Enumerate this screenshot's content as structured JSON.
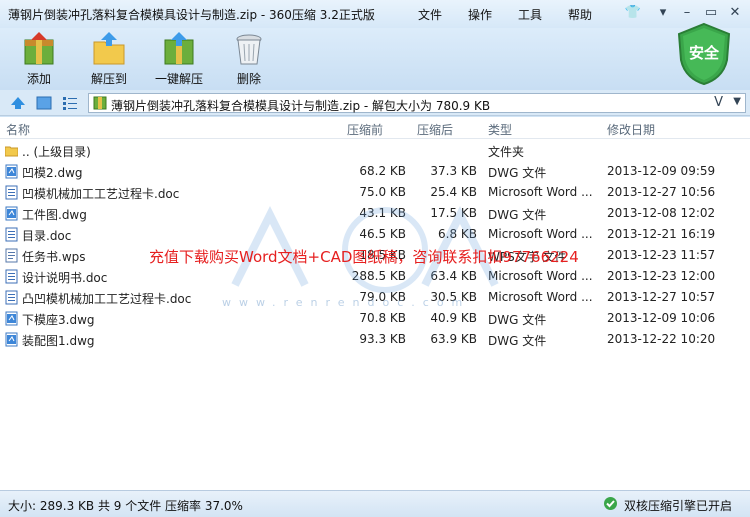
{
  "window": {
    "title": "薄钢片倒装冲孔落料复合模模具设计与制造.zip - 360压缩 3.2正式版",
    "menu": {
      "file": "文件",
      "action": "操作",
      "tools": "工具",
      "help": "帮助"
    }
  },
  "toolbar": {
    "add": "添加",
    "extract_to": "解压到",
    "one_click": "一键解压",
    "delete": "删除"
  },
  "badge": {
    "security": "安全"
  },
  "address": {
    "path": "薄钢片倒装冲孔落料复合模模具设计与制造.zip - 解包大小为 780.9 KB",
    "v_label": "V"
  },
  "columns": {
    "name": "名称",
    "packed": "压缩前",
    "unpacked": "压缩后",
    "type": "类型",
    "modified": "修改日期"
  },
  "files": [
    {
      "name": ".. (上级目录)",
      "packed": "",
      "unpacked": "",
      "type": "文件夹",
      "modified": "",
      "icon": "folder-icon"
    },
    {
      "name": "凹模2.dwg",
      "packed": "68.2 KB",
      "unpacked": "37.3 KB",
      "type": "DWG 文件",
      "modified": "2013-12-09 09:59",
      "icon": "dwg-icon"
    },
    {
      "name": "凹模机械加工工艺过程卡.doc",
      "packed": "75.0 KB",
      "unpacked": "25.4 KB",
      "type": "Microsoft Word ...",
      "modified": "2013-12-27 10:56",
      "icon": "doc-icon"
    },
    {
      "name": "工件图.dwg",
      "packed": "43.1 KB",
      "unpacked": "17.5 KB",
      "type": "DWG 文件",
      "modified": "2013-12-08 12:02",
      "icon": "dwg-icon"
    },
    {
      "name": "目录.doc",
      "packed": "46.5 KB",
      "unpacked": "6.8 KB",
      "type": "Microsoft Word ...",
      "modified": "2013-12-21 16:19",
      "icon": "doc-icon"
    },
    {
      "name": "任务书.wps",
      "packed": "18.5 KB",
      "unpacked": "",
      "type": "WPS文字 文件",
      "modified": "2013-12-23 11:57",
      "icon": "wps-icon"
    },
    {
      "name": "设计说明书.doc",
      "packed": "288.5 KB",
      "unpacked": "63.4 KB",
      "type": "Microsoft Word ...",
      "modified": "2013-12-23 12:00",
      "icon": "doc-icon"
    },
    {
      "name": "凸凹模机械加工工艺过程卡.doc",
      "packed": "79.0 KB",
      "unpacked": "30.5 KB",
      "type": "Microsoft Word ...",
      "modified": "2013-12-27 10:57",
      "icon": "doc-icon"
    },
    {
      "name": "下模座3.dwg",
      "packed": "70.8 KB",
      "unpacked": "40.9 KB",
      "type": "DWG 文件",
      "modified": "2013-12-09 10:06",
      "icon": "dwg-icon"
    },
    {
      "name": "装配图1.dwg",
      "packed": "93.3 KB",
      "unpacked": "63.9 KB",
      "type": "DWG 文件",
      "modified": "2013-12-22 10:20",
      "icon": "dwg-icon"
    }
  ],
  "overlay": {
    "promo": "充值下载购买Word文档+CAD图纸稿，咨询联系扣扣97766224",
    "watermark_text": "人人文库",
    "watermark_url": "www.renrendoc.com"
  },
  "status": {
    "summary": "大小: 289.3 KB 共 9 个文件 压缩率 37.0%",
    "engine": "双核压缩引擎已开启"
  },
  "colors": {
    "promo": "#e62020",
    "shield": "#3aa64a",
    "list_bg": "#ffffff"
  }
}
